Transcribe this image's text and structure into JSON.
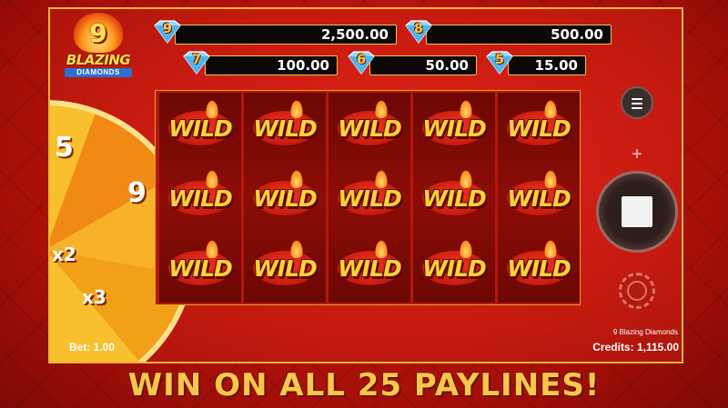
{
  "logo": {
    "number": "9",
    "title": "BLAZING",
    "subtitle": "DIAMONDS"
  },
  "jackpots": [
    {
      "gem": "9",
      "value": "2,500.00"
    },
    {
      "gem": "8",
      "value": "500.00"
    },
    {
      "gem": "7",
      "value": "100.00"
    },
    {
      "gem": "6",
      "value": "50.00"
    },
    {
      "gem": "5",
      "value": "15.00"
    }
  ],
  "wheel": {
    "labels": [
      "5",
      "9",
      "x2",
      "x3"
    ]
  },
  "reels": {
    "symbol_text": "WILD"
  },
  "controls": {
    "plus_symbol": "+"
  },
  "footer": {
    "bet": "Bet: 1.00",
    "game_name": "9 Blazing Diamonds",
    "credits": "Credits: 1,115.00"
  },
  "banner": "WIN ON ALL 25 PAYLINES!",
  "colors": {
    "gold": "#f7c64a",
    "red": "#c51a10",
    "dark": "#0d0906"
  }
}
